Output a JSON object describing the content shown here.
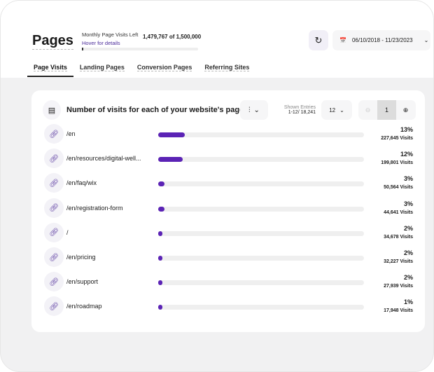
{
  "header": {
    "title": "Pages",
    "quota_label": "Monthly Page Visits Left",
    "quota_hover": "Hover for details",
    "quota_value": "1,479,767 of 1,500,000",
    "quota_used_fraction": 0.0135,
    "date_range": "06/10/2018 - 11/23/2023"
  },
  "tabs": [
    {
      "label": "Page Visits",
      "active": true
    },
    {
      "label": "Landing Pages"
    },
    {
      "label": "Conversion Pages"
    },
    {
      "label": "Referring Sites"
    }
  ],
  "card": {
    "title": "Number of visits for each of your website's pages",
    "entries_label": "Shown Entries",
    "entries_value": "1-12/ 18,241",
    "per_page": "12",
    "page": "1"
  },
  "accent": "#5b23b5",
  "rows": [
    {
      "path": "/en",
      "pct": "13%",
      "visits": "227,645 Visits",
      "value": 13
    },
    {
      "path": "/en/resources/digital-well...",
      "pct": "12%",
      "visits": "199,801 Visits",
      "value": 12
    },
    {
      "path": "/en/faq/wix",
      "pct": "3%",
      "visits": "50,564 Visits",
      "value": 3
    },
    {
      "path": "/en/registration-form",
      "pct": "3%",
      "visits": "44,641 Visits",
      "value": 3
    },
    {
      "path": "/",
      "pct": "2%",
      "visits": "34,678 Visits",
      "value": 2
    },
    {
      "path": "/en/pricing",
      "pct": "2%",
      "visits": "32,227 Visits",
      "value": 2
    },
    {
      "path": "/en/support",
      "pct": "2%",
      "visits": "27,939 Visits",
      "value": 2
    },
    {
      "path": "/en/roadmap",
      "pct": "1%",
      "visits": "17,948 Visits",
      "value": 1
    }
  ]
}
